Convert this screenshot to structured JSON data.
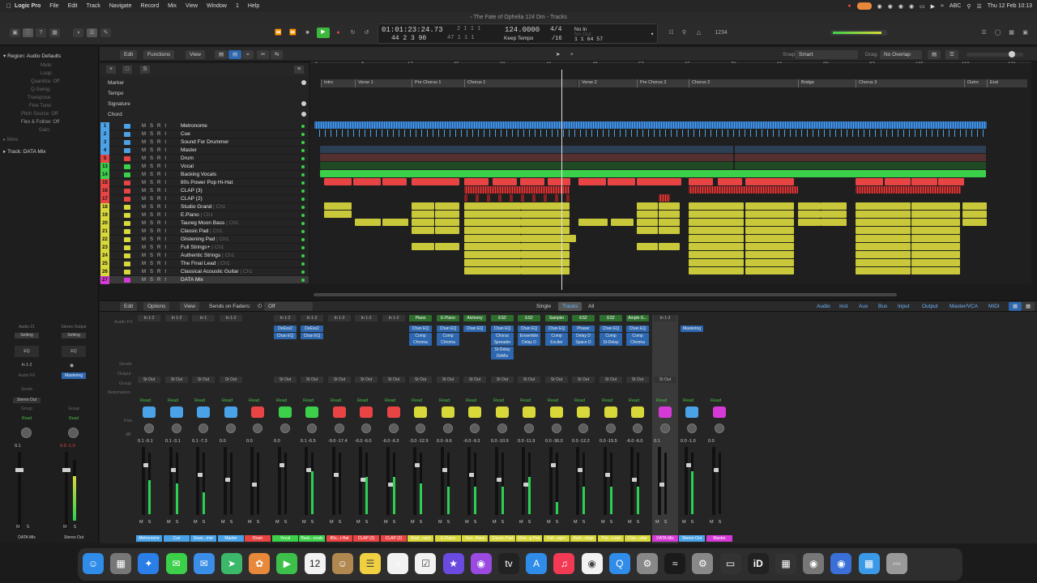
{
  "menubar": {
    "app": "Logic Pro",
    "items": [
      "File",
      "Edit",
      "Track",
      "Navigate",
      "Record",
      "Mix",
      "View",
      "Window",
      "1",
      "Help"
    ],
    "clock": "Thu 12 Feb 10:13",
    "input_label": "ABC"
  },
  "window": {
    "title": "The Fate of Ophelia 124 Dm - Tracks"
  },
  "lcd": {
    "time": "01:01:23:24.73",
    "bars": "44  2  3   90",
    "bars_top": "2   1   1     1",
    "bars_bottom": "47   1   1     1",
    "tempo": "124.0000",
    "tempo_mode": "Keep Tempo",
    "sig": "4/4",
    "division": "/16",
    "in_label": "No In",
    "out_label": "No Out",
    "position": "1   1   64  57"
  },
  "inspector": {
    "region": "Region: Audio Defaults",
    "params": [
      "Mute:",
      "Loop:",
      "Quantize: Off",
      "Q-Swing:",
      "Transpose:",
      "Fine Tune:",
      "Pitch Source: Off",
      "Flex & Follow: Off",
      "Gain:"
    ],
    "more": "More",
    "track": "Track: DATA Mix"
  },
  "tracks_header": {
    "edit": "Edit",
    "functions": "Functions",
    "view": "View",
    "snap_label": "Snap:",
    "snap_value": "Smart",
    "drag_label": "Drag:",
    "drag_value": "No Overlap"
  },
  "global_tracks": [
    "Marker",
    "Tempo",
    "Signature",
    "Chord"
  ],
  "ruler": [
    "1",
    "9",
    "17",
    "25",
    "33",
    "41",
    "49",
    "57",
    "65",
    "73",
    "81",
    "89",
    "97",
    "105",
    "113",
    "121"
  ],
  "markers": [
    "Intro",
    "Verse 1",
    "Pre Chorus 1",
    "Chorus 1",
    "Verse 2",
    "Pre Chorus 2",
    "Chorus 2",
    "Bridge",
    "Chorus 3",
    "Outro",
    "End"
  ],
  "tracks": [
    {
      "num": "1",
      "name": "Metronome",
      "sub": "",
      "color": "#4aa3e8"
    },
    {
      "num": "2",
      "name": "Cue",
      "sub": "",
      "color": "#4aa3e8"
    },
    {
      "num": "3",
      "name": "Sound For Drummer",
      "sub": "",
      "color": "#4aa3e8"
    },
    {
      "num": "4",
      "name": "Master",
      "sub": "",
      "color": "#4aa3e8"
    },
    {
      "num": "5",
      "name": "Drum",
      "sub": "",
      "color": "#e84444"
    },
    {
      "num": "13",
      "name": "Vocal",
      "sub": "",
      "color": "#3cd04a"
    },
    {
      "num": "14",
      "name": "Backing Vocals",
      "sub": "",
      "color": "#3cd04a"
    },
    {
      "num": "15",
      "name": "80s Power Pop Hi-Hat",
      "sub": "",
      "color": "#e84444"
    },
    {
      "num": "16",
      "name": "CLAP (3)",
      "sub": "",
      "color": "#e84444"
    },
    {
      "num": "17",
      "name": "CLAP (2)",
      "sub": "",
      "color": "#e84444"
    },
    {
      "num": "18",
      "name": "Studio Grand",
      "sub": "| Ch1",
      "color": "#d8d83a"
    },
    {
      "num": "19",
      "name": "E.Piano",
      "sub": "| Ch1",
      "color": "#d8d83a"
    },
    {
      "num": "20",
      "name": "Taureg Moon Bass",
      "sub": "| Ch1",
      "color": "#d8d83a"
    },
    {
      "num": "21",
      "name": "Classic Pad",
      "sub": "| Ch1",
      "color": "#d8d83a"
    },
    {
      "num": "22",
      "name": "Glistening Pad",
      "sub": "| Ch1",
      "color": "#d8d83a"
    },
    {
      "num": "23",
      "name": "Full Strings+",
      "sub": "| Ch1",
      "color": "#d8d83a"
    },
    {
      "num": "24",
      "name": "Authentic Strings",
      "sub": "| Ch1",
      "color": "#d8d83a"
    },
    {
      "num": "25",
      "name": "The Final Lead",
      "sub": "| Ch1",
      "color": "#d8d83a"
    },
    {
      "num": "26",
      "name": "Classical Acoustic Guitar",
      "sub": "| Ch1",
      "color": "#d8d83a"
    },
    {
      "num": "27",
      "name": "DATA Mix",
      "sub": "",
      "color": "#d63ad6"
    }
  ],
  "mixer_header": {
    "edit": "Edit",
    "options": "Options",
    "view": "View",
    "sends_label": "Sends on Faders:",
    "sends_value": "Off",
    "single": "Single",
    "tracks": "Tracks",
    "all": "All",
    "filters": [
      "Audio",
      "Inst",
      "Aux",
      "Bus",
      "Input",
      "Output",
      "Master/VCA",
      "MIDI"
    ]
  },
  "mixer_side_labels": [
    "Audio FX",
    "Sends",
    "Output",
    "Group",
    "Automation",
    "Pan",
    "dB"
  ],
  "channel_strips": [
    {
      "label": "Metronome",
      "io": "In 1-2",
      "plugins": [],
      "output": "St Out",
      "value": "0.1   -0.1",
      "color": "#4aa3e8",
      "meter": 0.55
    },
    {
      "label": "Cue",
      "io": "In 1-2",
      "plugins": [],
      "output": "St Out",
      "value": "0.1   -3.1",
      "color": "#4aa3e8",
      "meter": 0.5
    },
    {
      "label": "Soun...mer",
      "io": "In 1",
      "plugins": [],
      "output": "St Out",
      "value": "0.1   -7.3",
      "color": "#4aa3e8",
      "meter": 0.35
    },
    {
      "label": "Master",
      "io": "In 1-2",
      "plugins": [],
      "output": "St Out",
      "value": "0.0",
      "color": "#4aa3e8",
      "meter": 0.0
    },
    {
      "label": "Drum",
      "io": "",
      "plugins": [],
      "output": "",
      "value": "0.0",
      "color": "#e84444",
      "meter": 0.0
    },
    {
      "label": "Vocal",
      "io": "In 1-2",
      "plugins": [
        "DeEss2",
        "Chan EQ"
      ],
      "output": "St Out",
      "value": "0.0",
      "color": "#3cd04a",
      "meter": 0.0
    },
    {
      "label": "Back...ocals",
      "io": "In 1-2",
      "plugins": [
        "DeEss2",
        "Chan EQ"
      ],
      "output": "St Out",
      "value": "0.1   -6.5",
      "color": "#3cd04a",
      "meter": 0.7
    },
    {
      "label": "80s...i-Hat",
      "io": "In 1-2",
      "plugins": [],
      "output": "St Out",
      "value": "-9.0   -17.4",
      "color": "#e84444",
      "meter": 0.0
    },
    {
      "label": "CLAP (3)",
      "io": "In 1-2",
      "plugins": [],
      "output": "St Out",
      "value": "-6.0   -6.0",
      "color": "#e84444",
      "meter": 0.6
    },
    {
      "label": "CLAP (2)",
      "io": "In 1-2",
      "plugins": [],
      "output": "St Out",
      "value": "-6.0   -6.3",
      "color": "#e84444",
      "meter": 0.6
    },
    {
      "label": "Stud...rand",
      "io": "Piano",
      "plugins": [
        "Chan EQ",
        "Comp",
        "Chroma"
      ],
      "output": "St Out",
      "value": "-3.0   -12.9",
      "color": "#d8d83a",
      "meter": 0.5
    },
    {
      "label": "E.Piano",
      "io": "E-Piano",
      "plugins": [
        "Chan EQ",
        "Comp",
        "Chroma"
      ],
      "output": "St Out",
      "value": "0.0   -9.6",
      "color": "#d8d83a",
      "meter": 0.45
    },
    {
      "label": "Taur...Bass",
      "io": "Alchemy",
      "plugins": [
        "Chan EQ"
      ],
      "output": "St Out",
      "value": "-6.0   -9.3",
      "color": "#d8d83a",
      "meter": 0.45
    },
    {
      "label": "Classic Pad",
      "io": "ES2",
      "plugins": [
        "Chan EQ",
        "Chorus",
        "Spreader",
        "St-Delay",
        "DirMix"
      ],
      "output": "St Out",
      "value": "0.0   -10.9",
      "color": "#d8d83a",
      "meter": 0.45
    },
    {
      "label": "Glist...g Pad",
      "io": "ES2",
      "plugins": [
        "Chan EQ",
        "Ensemble",
        "Delay D"
      ],
      "output": "St Out",
      "value": "0.0   -11.9",
      "color": "#d8d83a",
      "meter": 0.6
    },
    {
      "label": "Full...ngs+",
      "io": "Sampler",
      "plugins": [
        "Chan EQ",
        "Comp",
        "Exciter"
      ],
      "output": "St Out",
      "value": "0.0   -36.0",
      "color": "#d8d83a",
      "meter": 0.2
    },
    {
      "label": "Auth...rings",
      "io": "ES2",
      "plugins": [
        "Phaser",
        "Delay D",
        "Space D"
      ],
      "output": "St Out",
      "value": "0.0   -12.2",
      "color": "#d8d83a",
      "meter": 0.45
    },
    {
      "label": "The...Lead",
      "io": "ES2",
      "plugins": [
        "Chan EQ",
        "Comp",
        "St-Delay"
      ],
      "output": "St Out",
      "value": "0.0   -15.5",
      "color": "#d8d83a",
      "meter": 0.45
    },
    {
      "label": "Clas...uitar",
      "io": "Ample G...",
      "plugins": [
        "Chan EQ",
        "Comp",
        "Chroma"
      ],
      "output": "St Out",
      "value": "-6.0   -6.0",
      "color": "#d8d83a",
      "meter": 0.45
    },
    {
      "label": "DATA Mix",
      "io": "In 1-2",
      "plugins": [],
      "output": "St Out",
      "value": "0.1",
      "color": "#d63ad6",
      "meter": 0.0
    },
    {
      "label": "Stereo Out",
      "io": "",
      "plugins": [
        "Mastering"
      ],
      "output": "",
      "value": "0.0   -1.0",
      "color": "#4aa3e8",
      "meter": 0.7
    },
    {
      "label": "Master",
      "io": "",
      "plugins": [],
      "output": "",
      "value": "0.0",
      "color": "#d63ad6",
      "meter": 0.0
    }
  ],
  "inspector_strips": [
    {
      "title": "Audio 21",
      "setting": "Setting",
      "eq": "EQ",
      "io": "In 1-2",
      "fx": "Audio FX",
      "sends": "Sends",
      "out": "Stereo Out",
      "group": "Group",
      "read": "Read",
      "value": "0.1",
      "label": "DATA Mix"
    },
    {
      "title": "Stereo Output",
      "setting": "Setting",
      "eq": "EQ",
      "io": "",
      "fx": "Mastering",
      "sends": "",
      "out": "",
      "group": "Group",
      "read": "Read",
      "value": "0.0   -1.0",
      "label": "Stereo Out"
    }
  ],
  "dock_icons": [
    "finder-icon",
    "launchpad-icon",
    "safari-icon",
    "messages-icon",
    "mail-icon",
    "maps-icon",
    "photos-icon",
    "facetime-icon",
    "calendar-icon",
    "contacts-icon",
    "notes-icon",
    "freeform-icon",
    "reminders-icon",
    "imovie-icon",
    "podcasts-icon",
    "tv-icon",
    "appstore-icon",
    "music-icon",
    "chrome-icon",
    "quicktime-icon",
    "settings-icon",
    "logic-icon",
    "systemprefs-icon",
    "ipad-icon",
    "id-icon",
    "piano-icon",
    "grey-icon",
    "blue-icon",
    "folder-icon",
    "trash-icon"
  ],
  "calendar_day": "12",
  "id_label": "iD"
}
